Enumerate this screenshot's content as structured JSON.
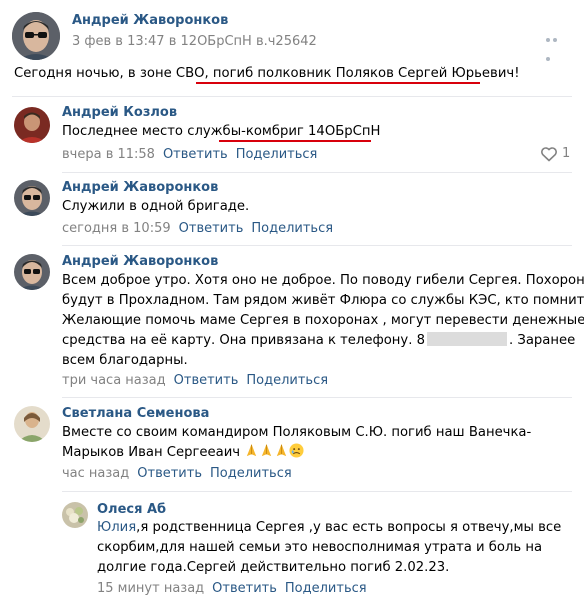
{
  "post": {
    "author": "Андрей Жаворонков",
    "date": "3 фев в 13:47",
    "via_prefix": "в",
    "group": "12ОБрСпН в.ч25642",
    "text_part1": "Сегодня ночью, в зоне СВО, ",
    "text_part2": "погиб полковник Поляков Сергей Юрьевич",
    "text_part3": "!"
  },
  "comments": [
    {
      "author": "Андрей Козлов",
      "text_part1": "Последнее место службы-",
      "text_part2": "комбриг 14ОБрСпН",
      "time": "вчера в 11:58",
      "reply": "Ответить",
      "share": "Поделиться",
      "likes": "1"
    },
    {
      "author": "Андрей Жаворонков",
      "text": "Служили в одной бригаде.",
      "time": "сегодня в 10:59",
      "reply": "Ответить",
      "share": "Поделиться"
    },
    {
      "author": "Андрей Жаворонков",
      "line1": "Всем доброе утро. Хотя оно не доброе. По поводу гибели Сергея. Похороны",
      "line2": "будут в Прохладном. Там рядом живёт Флюра со службы КЭС, кто помнит.",
      "line3": "Желающие помочь маме Сергея в похоронах , могут перевести денежные",
      "line4": "средства на её карту. Она привязана к телефону. 8",
      "line4_end": ". Заранее",
      "line5": "всем благодарны.",
      "time": "три часа назад",
      "reply": "Ответить",
      "share": "Поделиться"
    },
    {
      "author": "Светлана Семенова",
      "line1": "Вместе со своим командиром Поляковым С.Ю. погиб наш Ванечка-",
      "line2": "Марыков Иван Сергееаич",
      "time": "час назад",
      "reply": "Ответить",
      "share": "Поделиться"
    },
    {
      "author": "Олеся Аб",
      "addressee": "Юлия",
      "line1_rest": ",я родственница Сергея ,у вас есть вопросы я отвечу,мы все",
      "line2": "скорбим,для нашей семьи это невосполнимая утрата и боль на",
      "line3": "долгие года.Сергей действительно погиб 2.02.23.",
      "time": "15 минут назад",
      "reply": "Ответить",
      "share": "Поделиться"
    }
  ],
  "icons": {
    "more": "more-dots-icon",
    "like": "heart-icon",
    "pray": "folded-hands-emoji",
    "sad": "sad-face-emoji"
  },
  "colors": {
    "link": "#2a5885",
    "muted": "#828282",
    "underline": "#d8000c"
  }
}
